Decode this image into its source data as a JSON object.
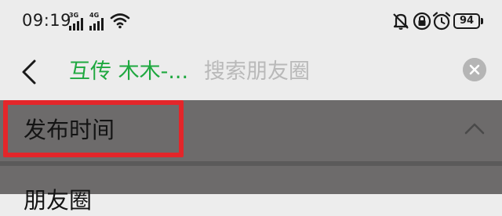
{
  "status_bar": {
    "time": "09:19",
    "signal_1_label": "3G",
    "signal_2_label": "4G",
    "battery_level": "94",
    "icons": [
      "signal-icon",
      "signal-icon",
      "wifi-icon",
      "mute-bell-icon",
      "lock-icon",
      "alarm-icon",
      "battery-icon"
    ]
  },
  "search": {
    "chip_label": "互传 木木-...",
    "placeholder": "搜索朋友圈"
  },
  "filter": {
    "section_title": "发布时间",
    "next_item_label": "朋友圈"
  },
  "colors": {
    "accent_green": "#1ea83f",
    "highlight_red": "#e3262a",
    "overlay": "#6d6b6b"
  }
}
